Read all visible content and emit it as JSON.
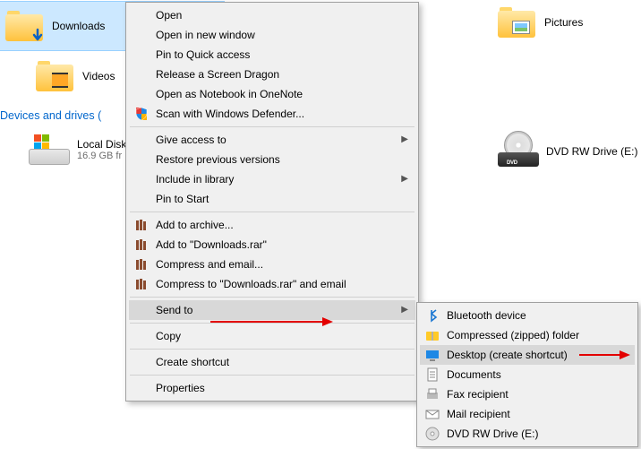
{
  "fs": {
    "downloads": "Downloads",
    "videos": "Videos",
    "pictures": "Pictures",
    "drivesHeader": "Devices and drives (",
    "localDisk": "Local Disk (",
    "localDiskFree": "16.9 GB fr",
    "dvd": "DVD RW Drive (E:)"
  },
  "menu": {
    "open": "Open",
    "openNew": "Open in new window",
    "pinQA": "Pin to Quick access",
    "dragon": "Release a Screen Dragon",
    "onenote": "Open as Notebook in OneNote",
    "defender": "Scan with Windows Defender...",
    "giveAccess": "Give access to",
    "restore": "Restore previous versions",
    "library": "Include in library",
    "pinStart": "Pin to Start",
    "addArchive": "Add to archive...",
    "addRar": "Add to \"Downloads.rar\"",
    "compressEmail": "Compress and email...",
    "compressRarEmail": "Compress to \"Downloads.rar\" and email",
    "sendTo": "Send to",
    "copy": "Copy",
    "createShortcut": "Create shortcut",
    "properties": "Properties"
  },
  "submenu": {
    "bluetooth": "Bluetooth device",
    "zipped": "Compressed (zipped) folder",
    "desktop": "Desktop (create shortcut)",
    "documents": "Documents",
    "fax": "Fax recipient",
    "mail": "Mail recipient",
    "dvd": "DVD RW Drive (E:)"
  }
}
